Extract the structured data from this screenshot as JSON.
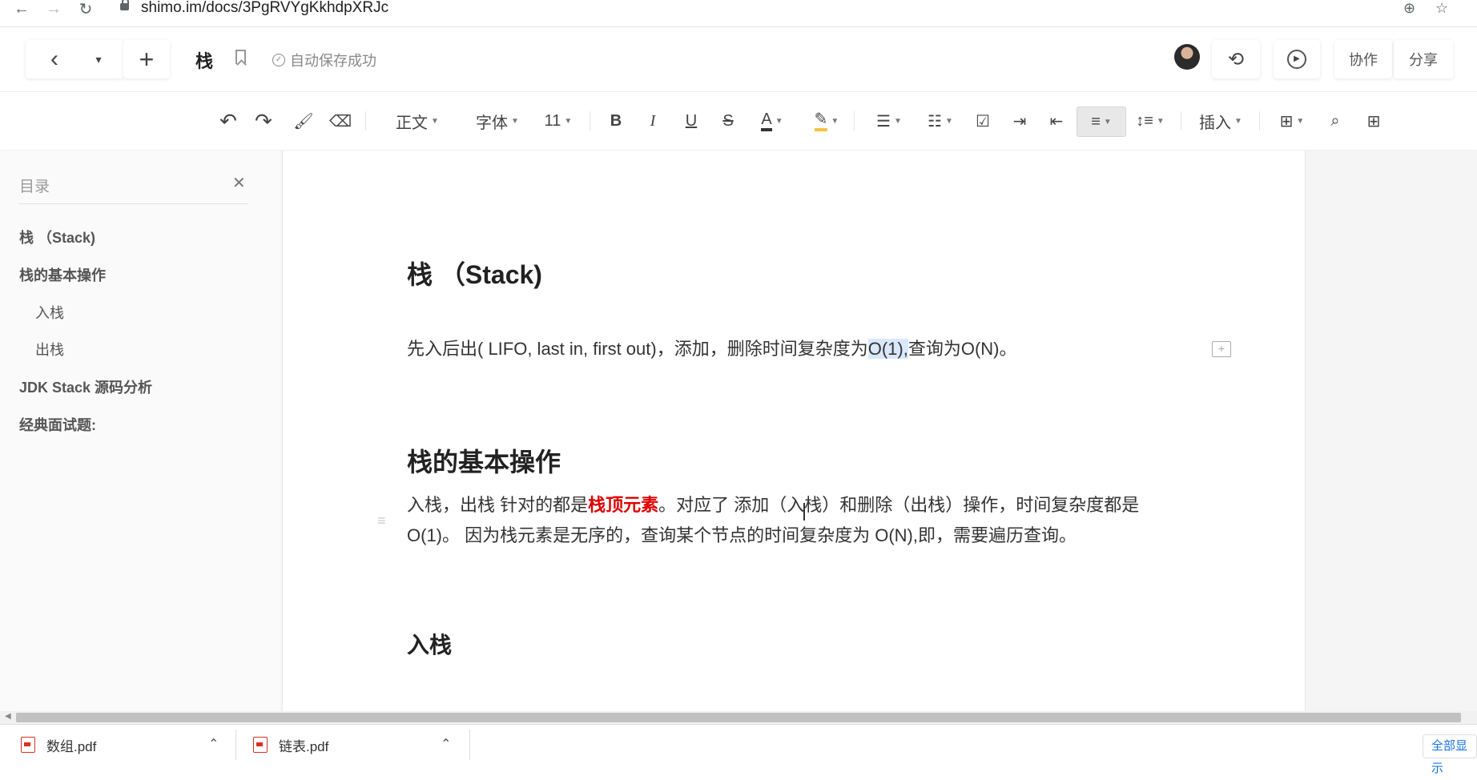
{
  "browser": {
    "url": "shimo.im/docs/3PgRVYgKkhdpXRJc",
    "back_icon": "arrow-left-icon",
    "forward_icon": "arrow-right-icon",
    "reload_icon": "reload-icon"
  },
  "header": {
    "back": "‹",
    "dropdown": "▾",
    "new": "+",
    "title": "栈",
    "save_status": "自动保存成功",
    "collab": "协作",
    "share": "分享"
  },
  "toolbar": {
    "style": "正文",
    "font": "字体",
    "size": "11",
    "bold": "B",
    "italic": "I",
    "underline": "U",
    "strike": "S",
    "font_color": "A",
    "insert": "插入",
    "underline_color": "#333333",
    "highlight_color": "#f5c242"
  },
  "sidebar": {
    "title": "目录",
    "items": [
      {
        "label": "栈 （Stack)",
        "level": 1
      },
      {
        "label": "栈的基本操作",
        "level": 1
      },
      {
        "label": "入栈",
        "level": 2
      },
      {
        "label": "出栈",
        "level": 2
      },
      {
        "label": "JDK Stack 源码分析",
        "level": 1
      },
      {
        "label": "经典面试题:",
        "level": 1
      }
    ]
  },
  "document": {
    "h1_stack": "栈 （Stack)",
    "p1_before": "先入后出( LIFO, last in, first out)，添加，删除时间复杂度为",
    "p1_highlight": "O(1),",
    "p1_after": "查询为O(N)。",
    "h1_ops": "栈的基本操作",
    "p2_before": "入栈，出栈 针对的都是",
    "p2_red": "栈顶元素",
    "p2_after": "。对应了 添加（入栈）和删除（出栈）操作，时间复杂度都是O(1)。 因为栈元素是无序的，查询某个节点的时间复杂度为 O(N),即，需要遍历查询。",
    "h2_push": "入栈"
  },
  "downloads": {
    "items": [
      "数组.pdf",
      "链表.pdf"
    ],
    "show_all": "全部显示"
  }
}
